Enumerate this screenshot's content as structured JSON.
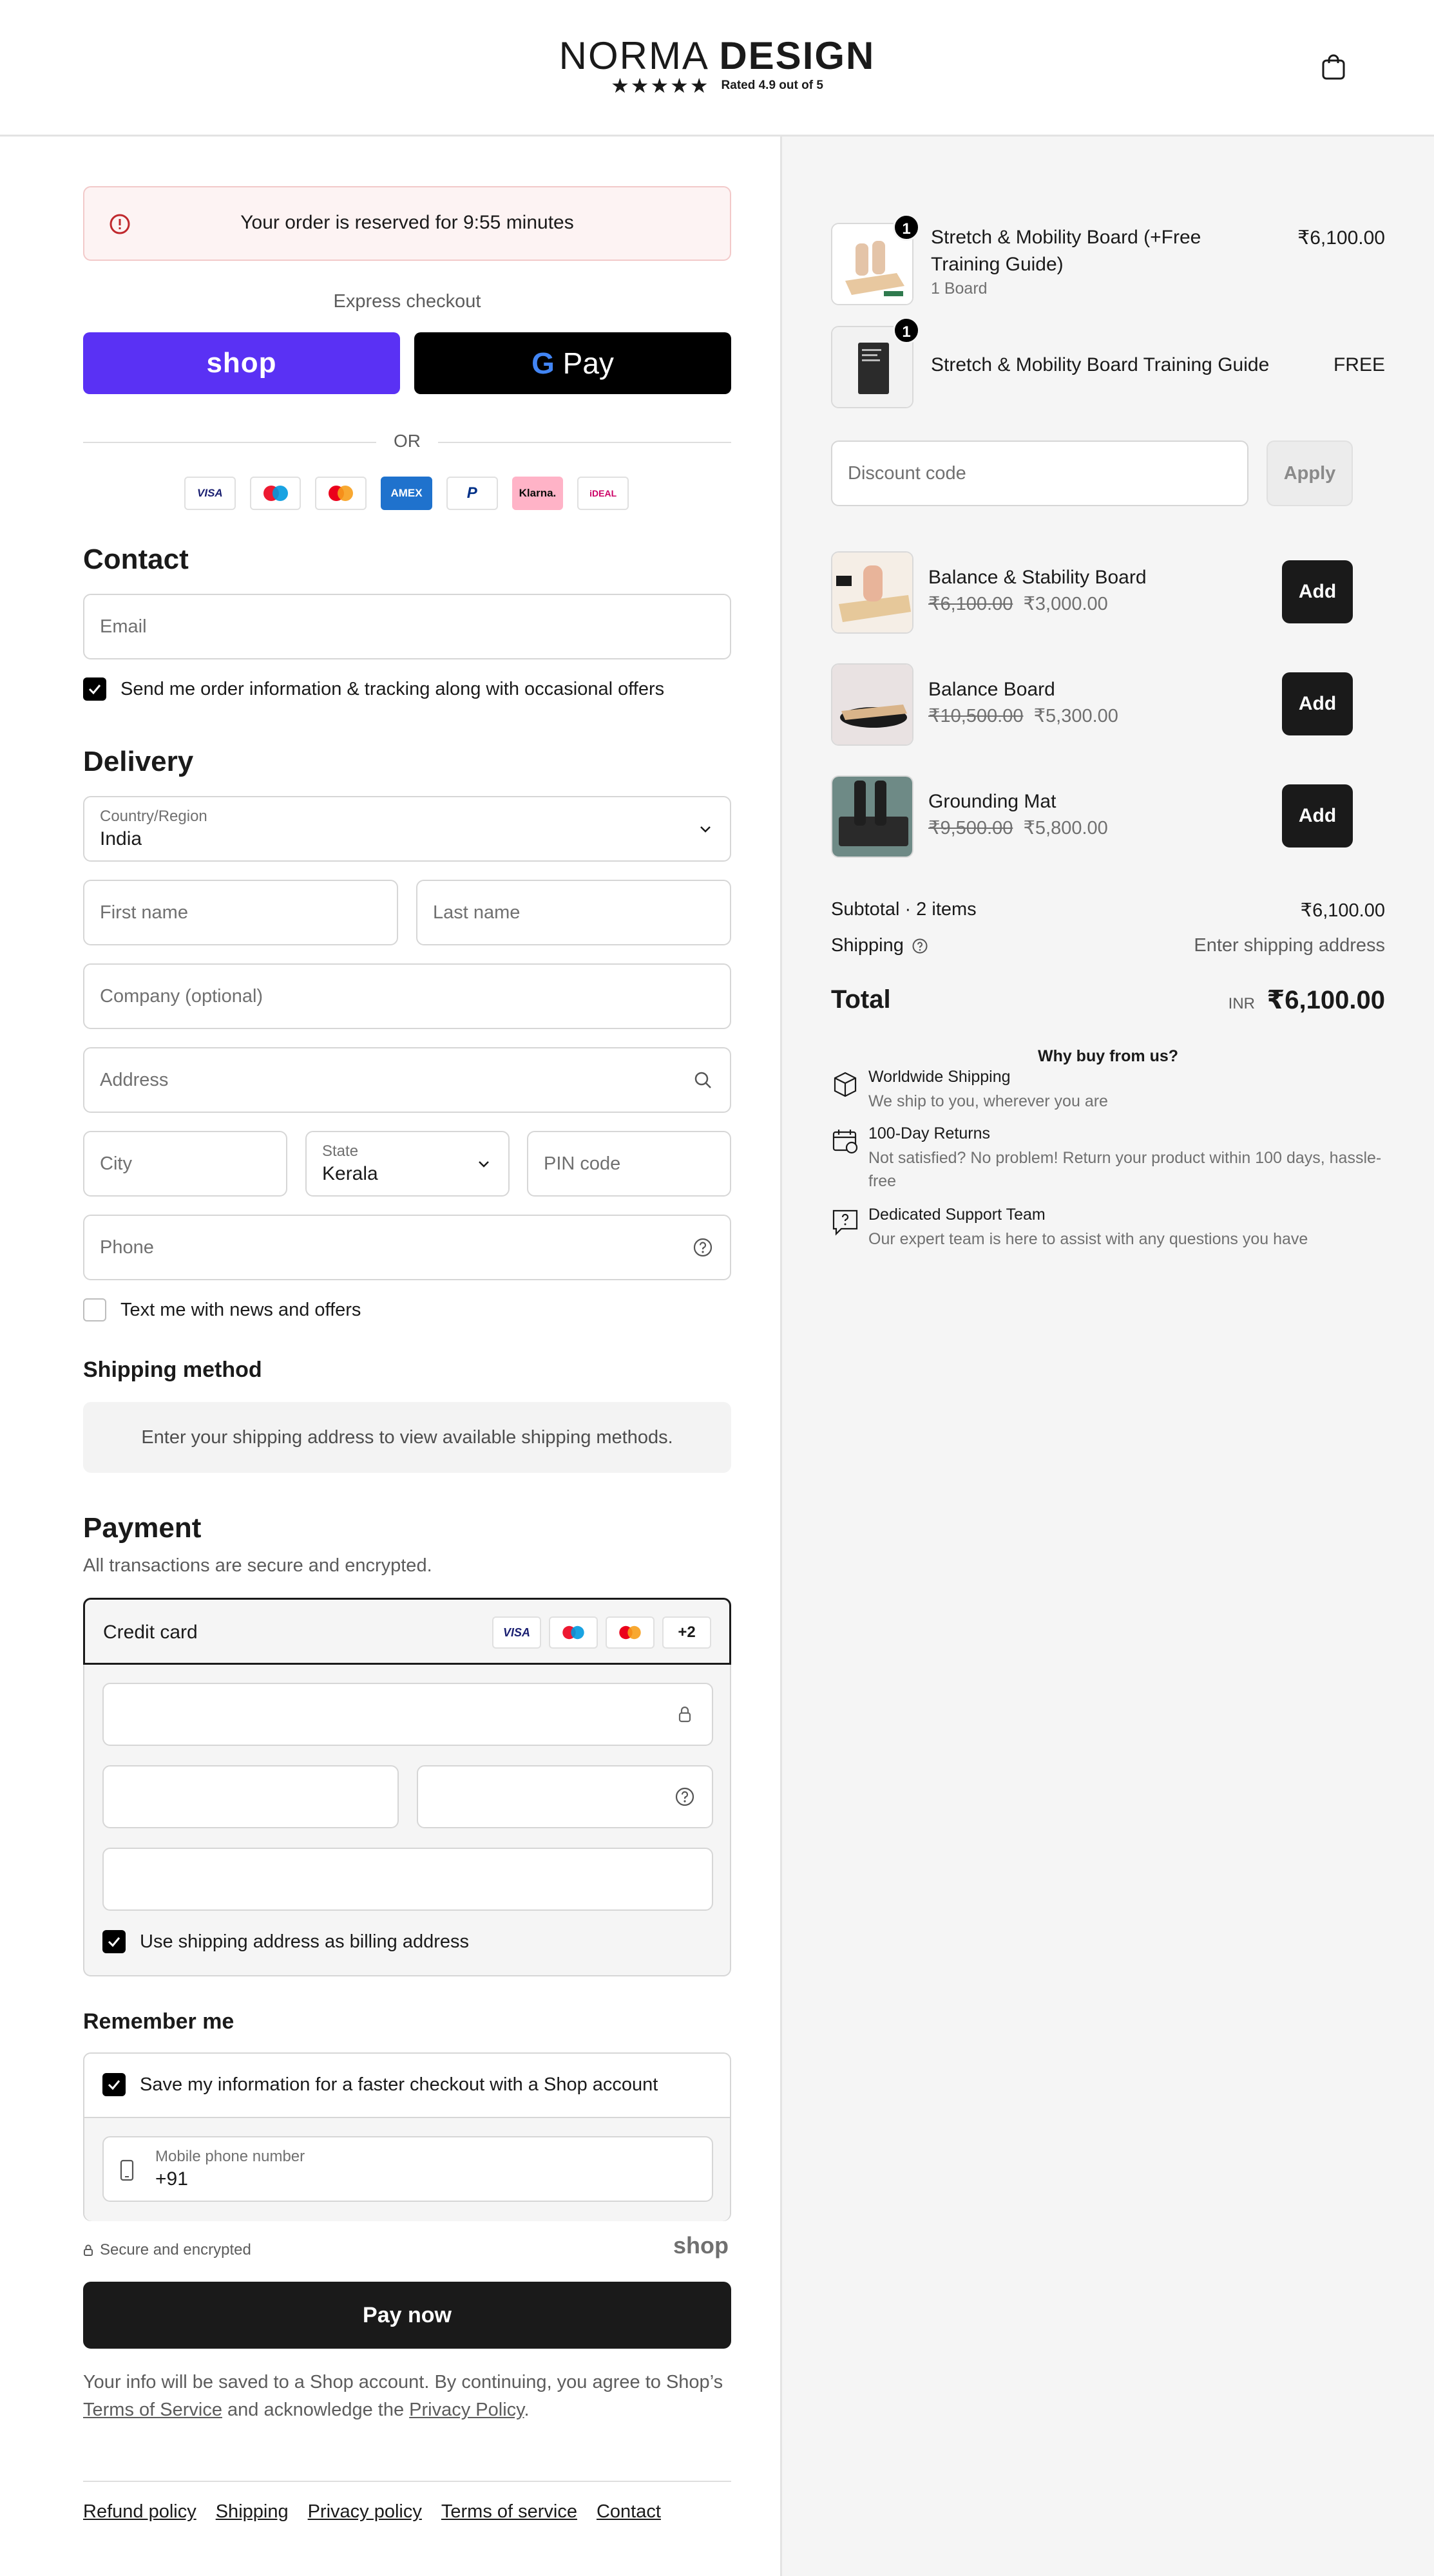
{
  "header": {
    "brand_thin": "NORMA",
    "brand_bold": "DESIGN",
    "stars": "★★★★★",
    "rating_text": "Rated 4.9 out of 5"
  },
  "reserve": {
    "text": "Your order is reserved for 9:55 minutes"
  },
  "express": {
    "label": "Express checkout",
    "shop_label": "shop",
    "gpay_g": "G",
    "gpay_label": " Pay",
    "or_label": "OR"
  },
  "payment_logos": [
    "VISA",
    "",
    "",
    "AMEX",
    "P",
    "Klarna.",
    "iDEAL"
  ],
  "contact": {
    "heading": "Contact",
    "email_placeholder": "Email",
    "offers_label": "Send me order information & tracking along with occasional offers"
  },
  "delivery": {
    "heading": "Delivery",
    "country_label": "Country/Region",
    "country_value": "India",
    "first_name": "First name",
    "last_name": "Last name",
    "company": "Company (optional)",
    "address": "Address",
    "city": "City",
    "state_label": "State",
    "state_value": "Kerala",
    "pin": "PIN code",
    "phone": "Phone",
    "text_offers_label": "Text me with news and offers"
  },
  "shipping_method": {
    "heading": "Shipping method",
    "info": "Enter your shipping address to view available shipping methods."
  },
  "payment": {
    "heading": "Payment",
    "subtitle": "All transactions are secure and encrypted.",
    "credit_card_label": "Credit card",
    "cards": [
      "VISA",
      "",
      "",
      "+2"
    ],
    "billing_label": "Use shipping address as billing address"
  },
  "remember": {
    "heading": "Remember me",
    "save_label": "Save my information for a faster checkout with a Shop account",
    "mobile_label": "Mobile phone number",
    "mobile_value": "+91"
  },
  "secure": {
    "text": "Secure and encrypted",
    "shop": "shop"
  },
  "pay_now": "Pay now",
  "legal": {
    "part1": "Your info will be saved to a Shop account. By continuing, you agree to Shop’s ",
    "tos": "Terms of Service",
    "part2": " and acknowledge the ",
    "privacy": "Privacy Policy",
    "part3": "."
  },
  "footer": [
    "Refund policy",
    "Shipping",
    "Privacy policy",
    "Terms of service",
    "Contact"
  ],
  "cart": {
    "items": [
      {
        "qty": "1",
        "title": "Stretch & Mobility Board (+Free Training Guide)",
        "sub": "1 Board",
        "price": "₹6,100.00"
      },
      {
        "qty": "1",
        "title": "Stretch & Mobility Board Training Guide",
        "sub": "",
        "price": "FREE"
      }
    ],
    "discount_placeholder": "Discount code",
    "apply_label": "Apply",
    "upsells": [
      {
        "title": "Balance & Stability Board",
        "old": "₹6,100.00",
        "new": "₹3,000.00",
        "add": "Add"
      },
      {
        "title": "Balance Board",
        "old": "₹10,500.00",
        "new": "₹5,300.00",
        "add": "Add"
      },
      {
        "title": "Grounding Mat",
        "old": "₹9,500.00",
        "new": "₹5,800.00",
        "add": "Add"
      }
    ],
    "subtotal_label": "Subtotal · 2 items",
    "subtotal_value": "₹6,100.00",
    "shipping_label": "Shipping",
    "shipping_value": "Enter shipping address",
    "total_label": "Total",
    "currency": "INR",
    "total_value": "₹6,100.00"
  },
  "why": {
    "heading": "Why buy from us?",
    "items": [
      {
        "title": "Worldwide Shipping",
        "desc": "We ship to you, wherever you are"
      },
      {
        "title": "100-Day Returns",
        "desc": "Not satisfied? No problem! Return your product within 100 days, hassle-free"
      },
      {
        "title": "Dedicated Support Team",
        "desc": "Our expert team is here to assist with any questions you have"
      }
    ]
  }
}
